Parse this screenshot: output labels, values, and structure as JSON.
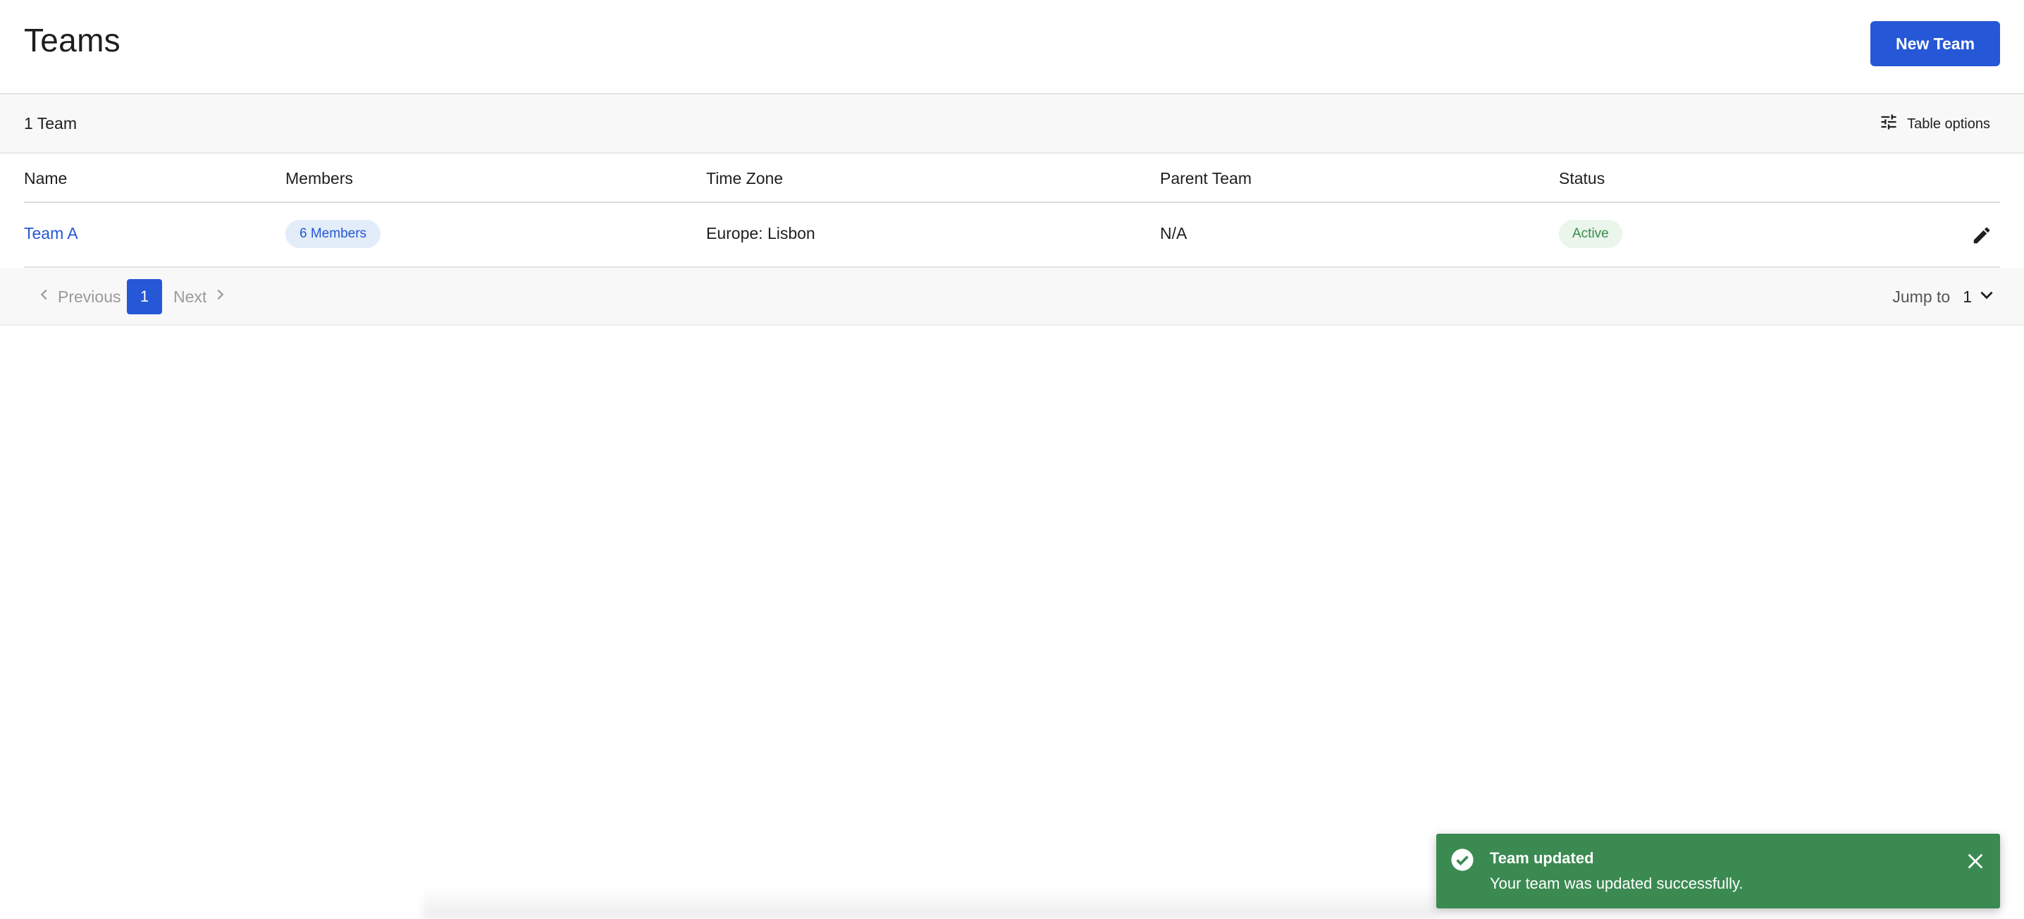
{
  "header": {
    "title": "Teams",
    "new_team_label": "New Team"
  },
  "summary": {
    "count_label": "1 Team",
    "table_options_label": "Table options"
  },
  "table": {
    "columns": [
      "Name",
      "Members",
      "Time Zone",
      "Parent Team",
      "Status"
    ],
    "rows": [
      {
        "name": "Team A",
        "members": "6 Members",
        "time_zone": "Europe: Lisbon",
        "parent_team": "N/A",
        "status": "Active"
      }
    ]
  },
  "pagination": {
    "previous_label": "Previous",
    "current_page": "1",
    "next_label": "Next",
    "jump_to_label": "Jump to",
    "jump_to_value": "1"
  },
  "toast": {
    "title": "Team updated",
    "message": "Your team was updated successfully."
  },
  "icons": {
    "table_options": "sliders-icon",
    "edit": "pencil-icon",
    "prev": "chevron-left-icon",
    "next": "chevron-right-icon",
    "jump_dropdown": "chevron-down-icon",
    "toast_status": "check-circle-icon",
    "toast_close": "close-icon"
  },
  "colors": {
    "primary": "#2557d6",
    "success": "#3b8a52",
    "status_active_text": "#3a8a4f",
    "status_active_bg": "#eaf5ec",
    "members_pill_bg": "#e3ecf9"
  }
}
